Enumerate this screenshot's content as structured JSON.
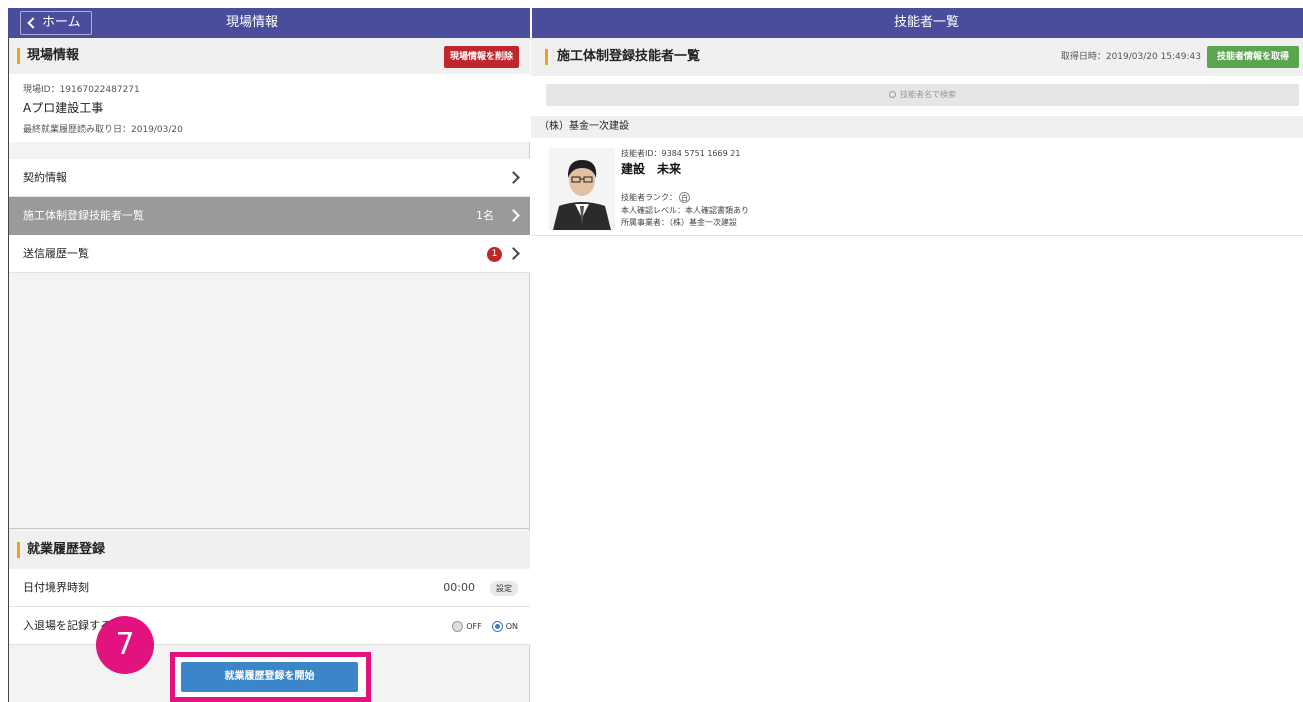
{
  "header": {
    "back_label": "ホーム",
    "left_title": "現場情報",
    "right_title": "技能者一覧"
  },
  "site": {
    "section_title": "現場情報",
    "delete_button": "現場情報を削除",
    "site_id": "現場ID：19167022487271",
    "site_name": "Aプロ建設工事",
    "last_read": "最終就業履歴読み取り日：2019/03/20"
  },
  "menu": {
    "items": [
      {
        "label": "契約情報",
        "count": "",
        "badge": ""
      },
      {
        "label": "施工体制登録技能者一覧",
        "count": "1名",
        "badge": ""
      },
      {
        "label": "送信履歴一覧",
        "count": "",
        "badge": "1"
      }
    ]
  },
  "work_history": {
    "section_title": "就業履歴登録",
    "date_boundary_label": "日付境界時刻",
    "date_boundary_value": "00:00",
    "set_button": "設定",
    "entry_exit_label": "入退場を記録する",
    "off_label": "OFF",
    "on_label": "ON",
    "selected": "ON",
    "start_button": "就業履歴登録を開始",
    "step_number": "7"
  },
  "workers": {
    "section_title": "施工体制登録技能者一覧",
    "fetched_at": "取得日時：2019/03/20 15:49:43",
    "fetch_button": "技能者情報を取得",
    "search_placeholder": "技能者名で検索",
    "company": "（株）基金一次建設",
    "list": [
      {
        "id": "技能者ID：9384 5751 1669 21",
        "name": "建設　未来",
        "rank_label": "技能者ランク：",
        "rank": "白",
        "confirmation": "本人確認レベル：本人確認書類あり",
        "affiliation": "所属事業者：（株）基金一次建設"
      }
    ]
  },
  "colors": {
    "header_bg": "#4a4d9c",
    "accent_bar": "#f0a020",
    "danger": "#c0272d",
    "primary": "#3a86c8",
    "success": "#5aa650",
    "highlight": "#e2127e"
  }
}
